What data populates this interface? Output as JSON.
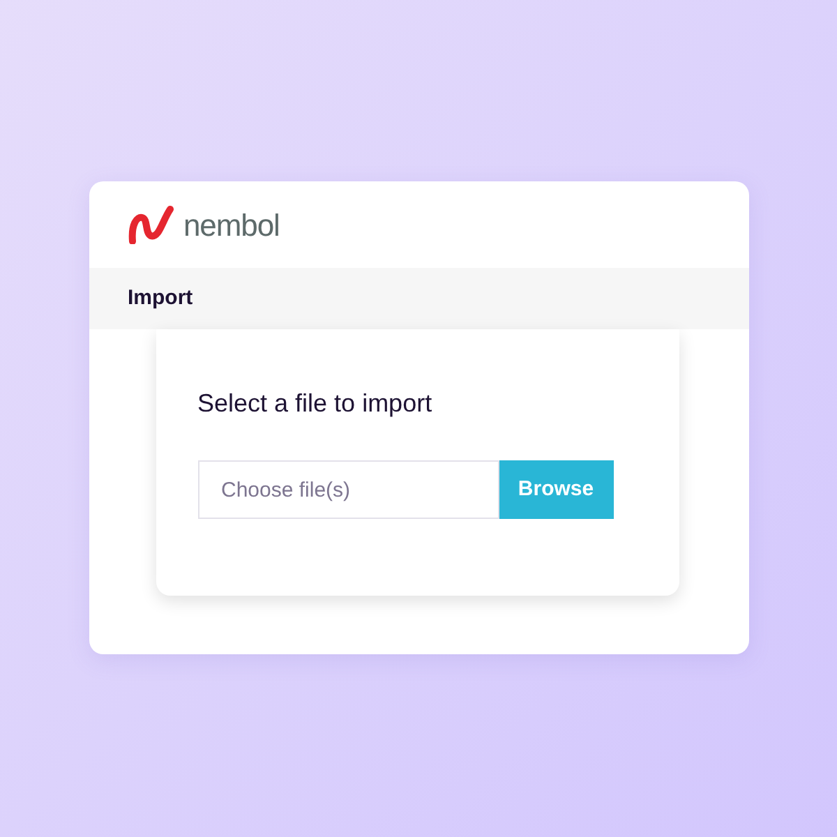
{
  "brand": {
    "name": "nembol"
  },
  "section_bar": {
    "title": "Import"
  },
  "import_card": {
    "heading": "Select a file to import",
    "file_field": {
      "placeholder": "Choose file(s)"
    },
    "browse_button": "Browse"
  }
}
